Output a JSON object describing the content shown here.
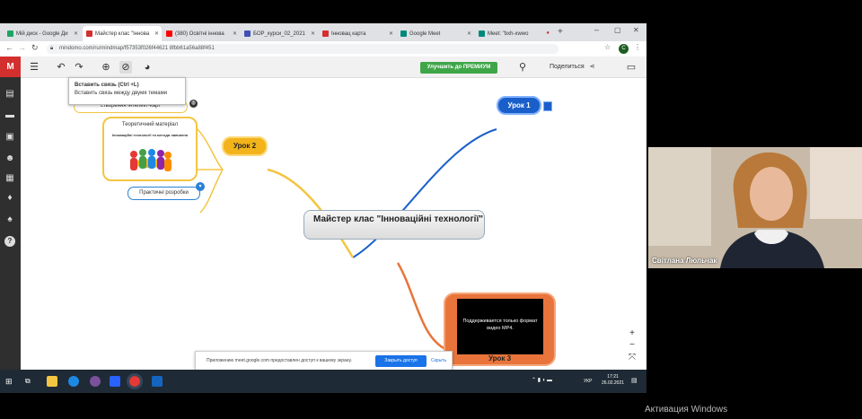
{
  "browser": {
    "tabs": [
      {
        "label": "Мій диск - Google Ди",
        "icon_color": "#1fa463",
        "active": false
      },
      {
        "label": "Майстер клас \"Іннова",
        "icon_color": "#d32f2f",
        "active": true
      },
      {
        "label": "(380) Освітні іннова",
        "icon_color": "#ff0000",
        "active": false
      },
      {
        "label": "БОР_курси_02_2021",
        "icon_color": "#3f51b5",
        "active": false
      },
      {
        "label": "Інновац карта",
        "icon_color": "#d32f2f",
        "active": false
      },
      {
        "label": "Google Meet",
        "icon_color": "#00897b",
        "active": false
      },
      {
        "label": "Meet: \"bxh-xwwo",
        "icon_color": "#00897b",
        "active": false
      }
    ],
    "new_tab_symbol": "+",
    "url": "mindomo.com/ru/mindmap/f57353f026f44621 8fbb61a56a88f451",
    "profile_initial": "C"
  },
  "app": {
    "toolbar": {
      "premium_label": "Улучшить до ПРЕМИУМ",
      "share_label": "Поделиться"
    },
    "tooltip": {
      "title": "Вставить связь (Ctrl +L)",
      "description": "Вставить связь между двумя темами"
    },
    "nodes": {
      "center": "Майстер клас \"Інноваційні технології\"",
      "lesson1": "Урок 1",
      "lesson2": "Урок 2",
      "lesson3": "Урок 3",
      "intellect_maps": "створення інтелект-карт",
      "theory_title": "Теоретичний матеріал",
      "theory_subtitle": "Інноваційні технології та методи навчання",
      "practical": "Практичні розробки",
      "video_message": "Поддерживается только формат видео MP4."
    },
    "notification": {
      "message": "Приложению meet.google.com предоставлен доступ к вашему экрану.",
      "stop_button": "Закрыть доступ",
      "hide_link": "Скрыть"
    },
    "zoom": {
      "in": "+",
      "out": "−",
      "fit": "⤧"
    }
  },
  "taskbar": {
    "time": "17:21",
    "date": "26.02.2021",
    "lang": "УКР"
  },
  "webcam": {
    "participant_name": "Світлана Люльчак"
  },
  "os_watermark": "Активация Windows",
  "colors": {
    "lesson1": "#1a5fc9",
    "lesson2": "#f2b31b",
    "lesson3": "#e8743b",
    "premium": "#3fa648",
    "taskbar": "#1e2a35"
  }
}
